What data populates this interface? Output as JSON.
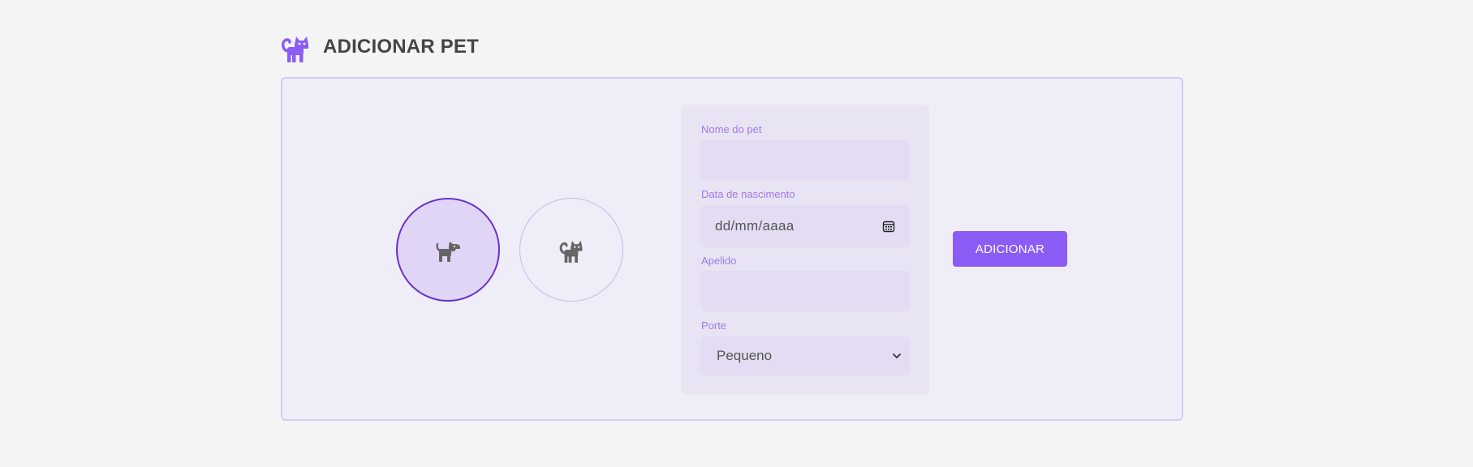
{
  "header": {
    "title": "ADICIONAR PET",
    "icon": "cat-icon",
    "icon_color": "#8b5cf6"
  },
  "species": [
    {
      "id": "dog",
      "icon": "dog-icon",
      "selected": true
    },
    {
      "id": "cat",
      "icon": "cat-icon",
      "selected": false
    }
  ],
  "form": {
    "name": {
      "label": "Nome do pet",
      "value": ""
    },
    "birth_date": {
      "label": "Data de nascimento",
      "placeholder": "dd/mm/aaaa",
      "icon": "calendar-icon"
    },
    "nickname": {
      "label": "Apelido",
      "value": ""
    },
    "size": {
      "label": "Porte",
      "selected": "Pequeno",
      "icon": "chevron-down-icon"
    }
  },
  "actions": {
    "add_label": "ADICIONAR",
    "add_color": "#8b5cf6"
  },
  "colors": {
    "background": "#f4f4f4",
    "card_background": "#efedf7",
    "card_border": "#d4cbf6",
    "selected_border": "#6a2fc7",
    "label": "#9b7bea",
    "title": "#444444"
  }
}
